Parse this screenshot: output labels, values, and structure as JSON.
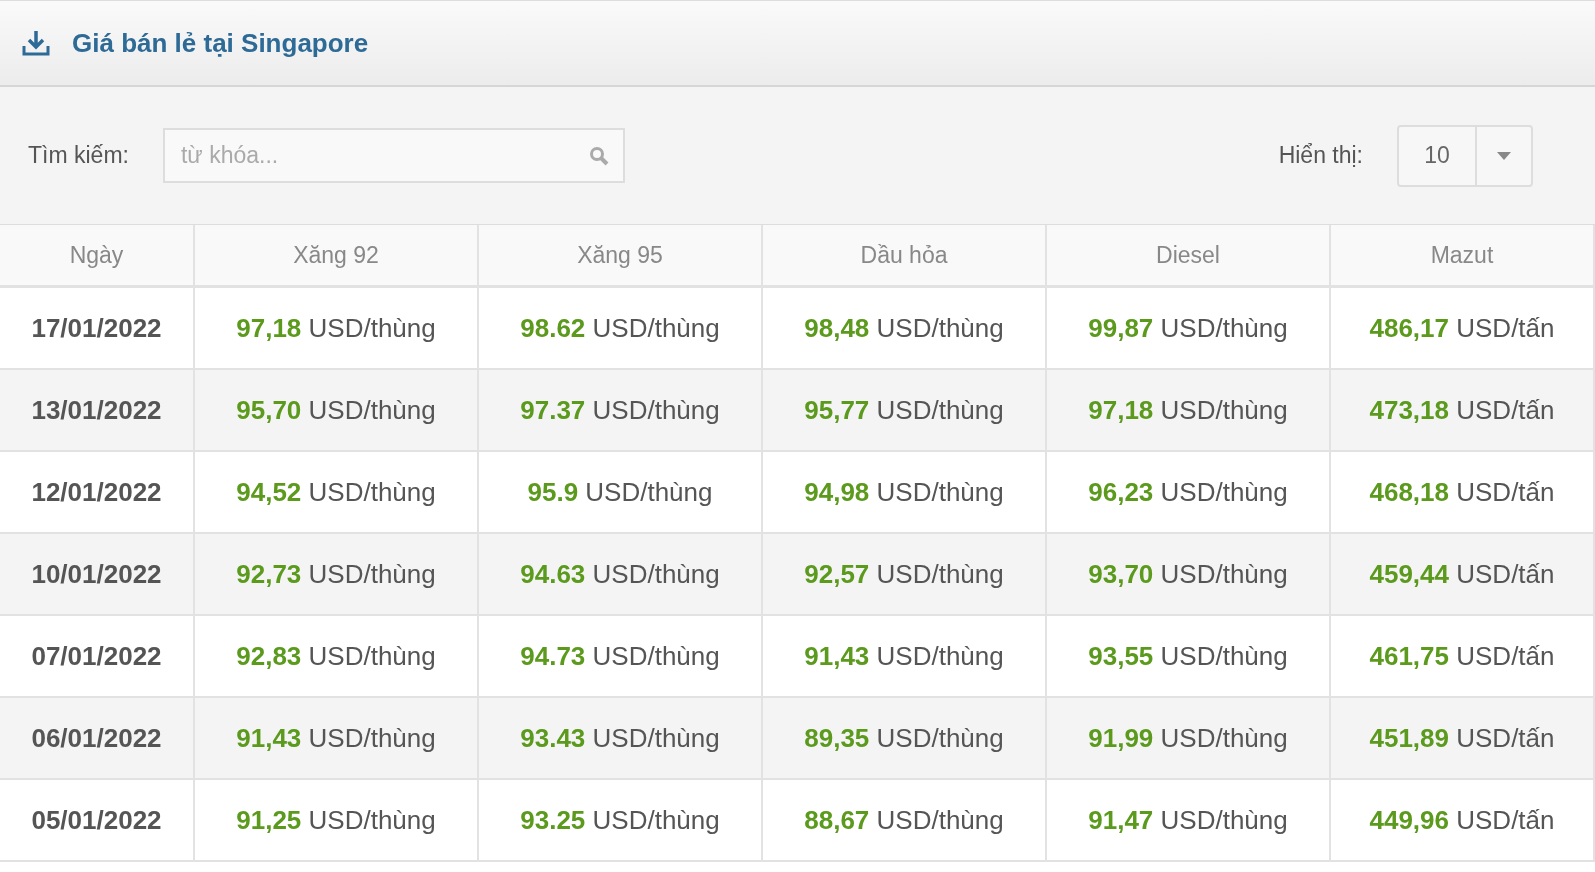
{
  "panel": {
    "title": "Giá bán lẻ tại Singapore"
  },
  "search": {
    "label": "Tìm kiếm:",
    "placeholder": "từ khóa..."
  },
  "page_size": {
    "label": "Hiển thị:",
    "value": "10"
  },
  "table": {
    "columns": [
      "Ngày",
      "Xăng 92",
      "Xăng 95",
      "Dầu hỏa",
      "Diesel",
      "Mazut"
    ],
    "rows": [
      {
        "cells": [
          {
            "kind": "date",
            "text": "17/01/2022"
          },
          {
            "kind": "price",
            "value": "97,18",
            "unit": "USD/thùng"
          },
          {
            "kind": "price",
            "value": "98.62",
            "unit": "USD/thùng"
          },
          {
            "kind": "price",
            "value": "98,48",
            "unit": "USD/thùng"
          },
          {
            "kind": "price",
            "value": "99,87",
            "unit": "USD/thùng"
          },
          {
            "kind": "price",
            "value": "486,17",
            "unit": "USD/tấn"
          }
        ]
      },
      {
        "cells": [
          {
            "kind": "date",
            "text": "13/01/2022"
          },
          {
            "kind": "price",
            "value": "95,70",
            "unit": "USD/thùng"
          },
          {
            "kind": "price",
            "value": "97.37",
            "unit": "USD/thùng"
          },
          {
            "kind": "price",
            "value": "95,77",
            "unit": "USD/thùng"
          },
          {
            "kind": "price",
            "value": "97,18",
            "unit": "USD/thùng"
          },
          {
            "kind": "price",
            "value": "473,18",
            "unit": "USD/tấn"
          }
        ]
      },
      {
        "cells": [
          {
            "kind": "date",
            "text": "12/01/2022"
          },
          {
            "kind": "price",
            "value": "94,52",
            "unit": "USD/thùng"
          },
          {
            "kind": "price",
            "value": "95.9",
            "unit": "USD/thùng"
          },
          {
            "kind": "price",
            "value": "94,98",
            "unit": "USD/thùng"
          },
          {
            "kind": "price",
            "value": "96,23",
            "unit": "USD/thùng"
          },
          {
            "kind": "price",
            "value": "468,18",
            "unit": "USD/tấn"
          }
        ]
      },
      {
        "cells": [
          {
            "kind": "date",
            "text": "10/01/2022"
          },
          {
            "kind": "price",
            "value": "92,73",
            "unit": "USD/thùng"
          },
          {
            "kind": "price",
            "value": "94.63",
            "unit": "USD/thùng"
          },
          {
            "kind": "price",
            "value": "92,57",
            "unit": "USD/thùng"
          },
          {
            "kind": "price",
            "value": "93,70",
            "unit": "USD/thùng"
          },
          {
            "kind": "price",
            "value": "459,44",
            "unit": "USD/tấn"
          }
        ]
      },
      {
        "cells": [
          {
            "kind": "date",
            "text": "07/01/2022"
          },
          {
            "kind": "price",
            "value": "92,83",
            "unit": "USD/thùng"
          },
          {
            "kind": "price",
            "value": "94.73",
            "unit": "USD/thùng"
          },
          {
            "kind": "price",
            "value": "91,43",
            "unit": "USD/thùng"
          },
          {
            "kind": "price",
            "value": "93,55",
            "unit": "USD/thùng"
          },
          {
            "kind": "price",
            "value": "461,75",
            "unit": "USD/tấn"
          }
        ]
      },
      {
        "cells": [
          {
            "kind": "date",
            "text": "06/01/2022"
          },
          {
            "kind": "price",
            "value": "91,43",
            "unit": "USD/thùng"
          },
          {
            "kind": "price",
            "value": "93.43",
            "unit": "USD/thùng"
          },
          {
            "kind": "price",
            "value": "89,35",
            "unit": "USD/thùng"
          },
          {
            "kind": "price",
            "value": "91,99",
            "unit": "USD/thùng"
          },
          {
            "kind": "price",
            "value": "451,89",
            "unit": "USD/tấn"
          }
        ]
      },
      {
        "cells": [
          {
            "kind": "date",
            "text": "05/01/2022"
          },
          {
            "kind": "price",
            "value": "91,25",
            "unit": "USD/thùng"
          },
          {
            "kind": "price",
            "value": "93.25",
            "unit": "USD/thùng"
          },
          {
            "kind": "price",
            "value": "88,67",
            "unit": "USD/thùng"
          },
          {
            "kind": "price",
            "value": "91,47",
            "unit": "USD/thùng"
          },
          {
            "kind": "price",
            "value": "449,96",
            "unit": "USD/tấn"
          }
        ]
      }
    ]
  }
}
